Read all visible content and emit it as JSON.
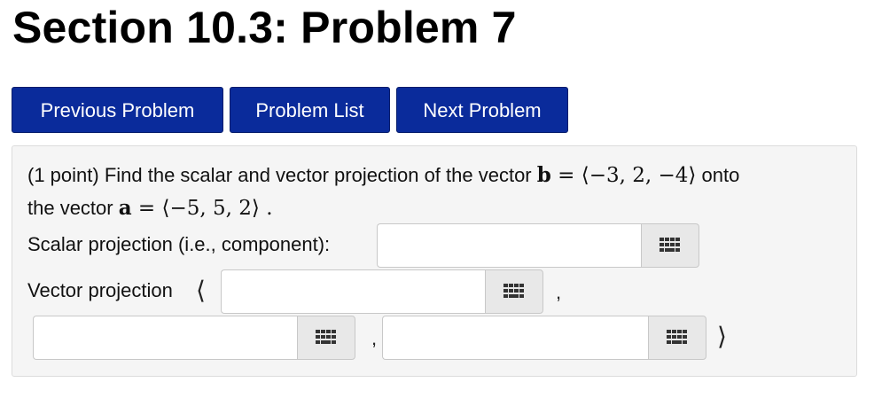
{
  "header": {
    "title": "Section 10.3: Problem 7"
  },
  "nav": {
    "previous_label": "Previous Problem",
    "list_label": "Problem List",
    "next_label": "Next Problem"
  },
  "problem": {
    "intro": "(1 point) Find the scalar and vector projection of the vector ",
    "vec_b_name": "b",
    "vec_b_value": " = ⟨−3, 2, −4⟩",
    "onto": " onto",
    "line2_prefix": "the vector ",
    "vec_a_name": "a",
    "vec_a_value": " = ⟨−5, 5, 2⟩",
    "line2_suffix": " .",
    "scalar_label": "Scalar projection (i.e., component):",
    "vector_label": "Vector projection",
    "open_angle": "⟨",
    "close_angle": "⟩",
    "comma": ","
  },
  "inputs": {
    "scalar_value": "",
    "vector_x_value": "",
    "vector_y_value": "",
    "vector_z_value": ""
  },
  "icons": {
    "keyboard": "keyboard-icon"
  },
  "colors": {
    "nav_button_bg": "#0a2b9b",
    "nav_button_text": "#ffffff",
    "problem_bg": "#f5f5f5"
  }
}
